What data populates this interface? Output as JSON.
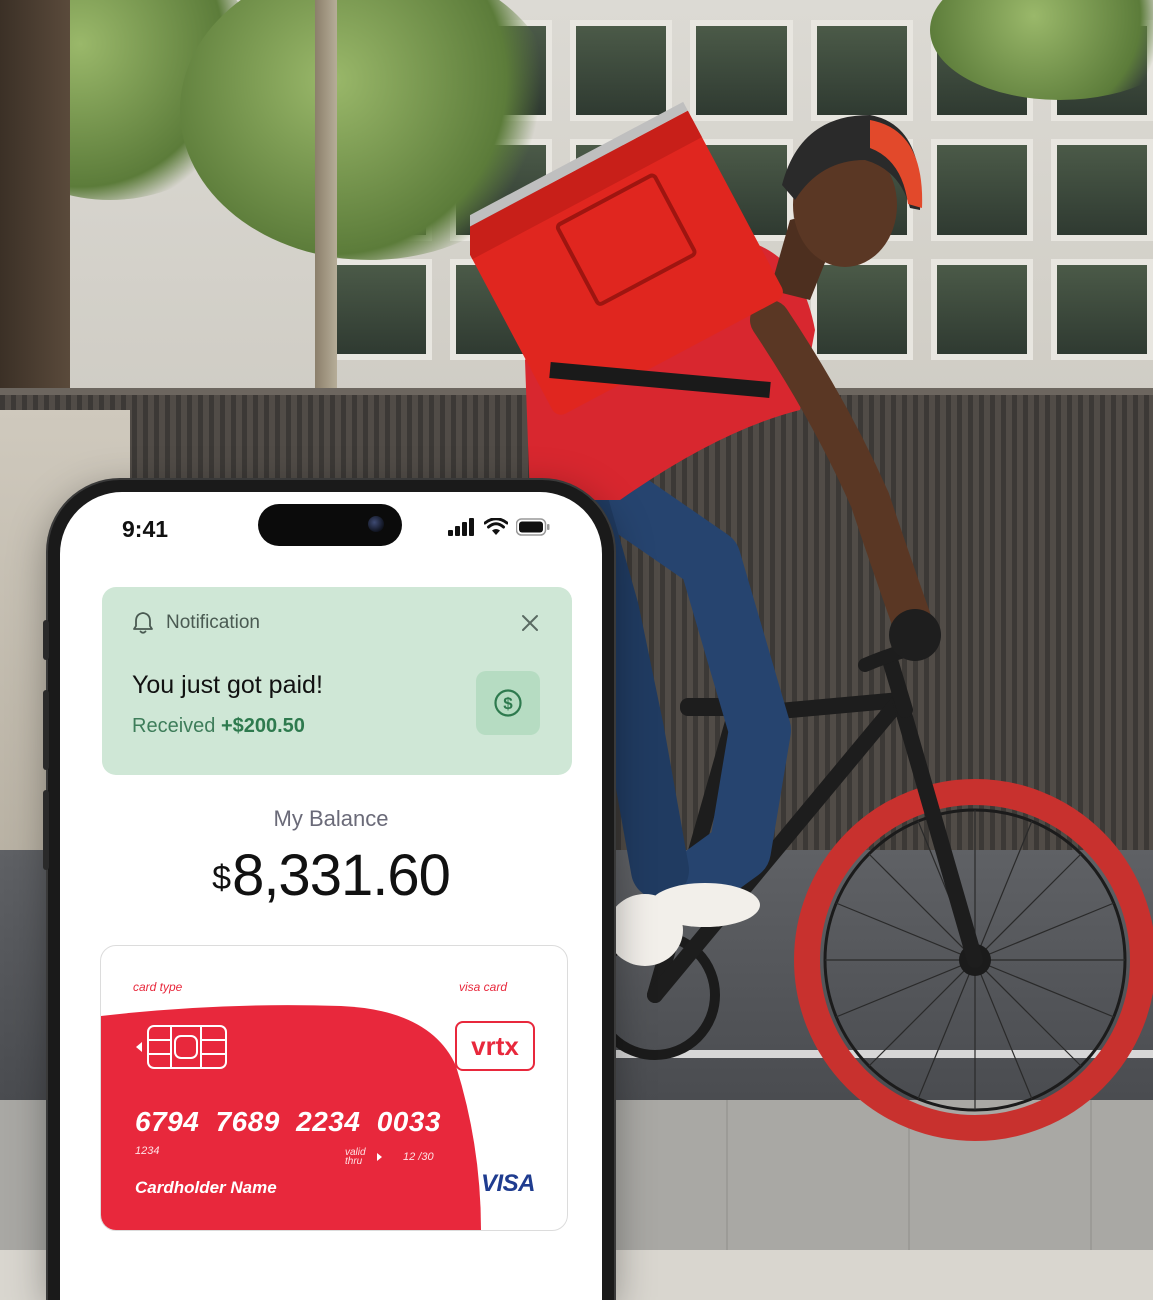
{
  "status_bar": {
    "time": "9:41"
  },
  "notification": {
    "header": "Notification",
    "title": "You just got paid!",
    "subtitle_prefix": "Received",
    "amount": "+$200.50",
    "icons": {
      "bell": "bell-icon",
      "close": "close-icon",
      "money": "dollar-coin-icon"
    }
  },
  "balance": {
    "label": "My Balance",
    "currency": "$",
    "amount": "8,331.60"
  },
  "card": {
    "type_label": "card type",
    "network_label": "visa card",
    "brand": "vrtx",
    "number": "6794 7689 2234 0033",
    "small_number": "1234",
    "valid_label_line1": "valid",
    "valid_label_line2": "thru",
    "expiry": "12 /30",
    "holder": "Cardholder Name",
    "network": "VISA",
    "colors": {
      "red": "#e8283c",
      "visa_blue": "#1f3c8f"
    }
  },
  "theme": {
    "notification_bg": "#cfe7d6",
    "accent_green": "#2e7a4e"
  }
}
